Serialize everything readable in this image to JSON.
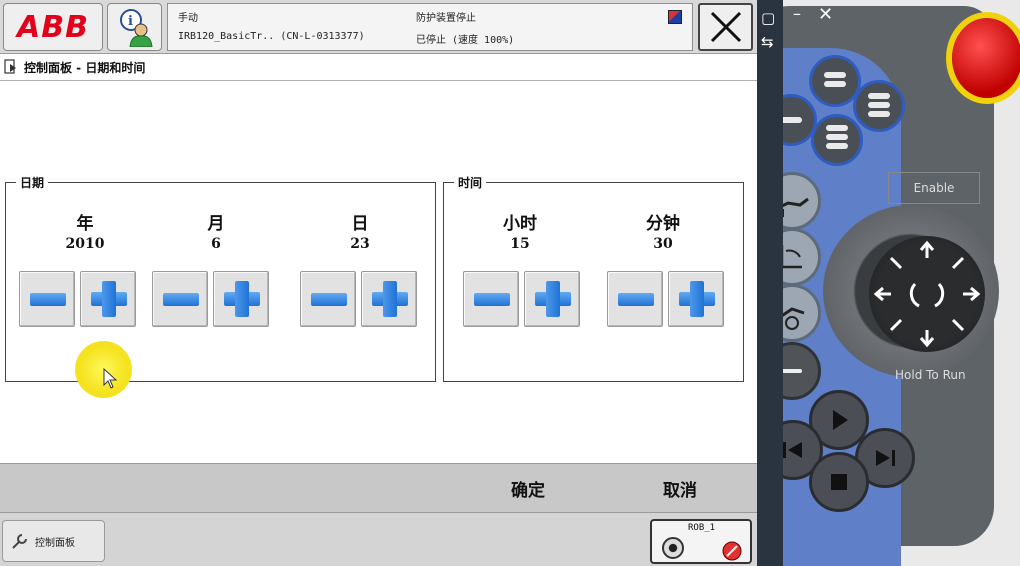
{
  "topbar": {
    "logo": "ABB",
    "status": {
      "mode": "手动",
      "program": "IRB120_BasicTr..  (CN-L-0313377)",
      "safety": "防护装置停止",
      "state": "已停止 (速度 100%)"
    }
  },
  "breadcrumb": {
    "text": "控制面板 - 日期和时间"
  },
  "date_group": {
    "title": "日期",
    "units": [
      {
        "label": "年",
        "value": "2010"
      },
      {
        "label": "月",
        "value": "6"
      },
      {
        "label": "日",
        "value": "23"
      }
    ]
  },
  "time_group": {
    "title": "时间",
    "units": [
      {
        "label": "小时",
        "value": "15"
      },
      {
        "label": "分钟",
        "value": "30"
      }
    ]
  },
  "actions": {
    "ok": "确定",
    "cancel": "取消"
  },
  "taskbar": {
    "control_panel": "控制面板",
    "robot_label": "ROB_1"
  },
  "pendant": {
    "enable_label": "Enable",
    "hold_to_run_label": "Hold To Run"
  },
  "colors": {
    "abb_red": "#e2001a",
    "button_blue": "#1f72d6",
    "pointer_highlight": "#f4e21c",
    "pendant_blue": "#5f7fc8"
  }
}
